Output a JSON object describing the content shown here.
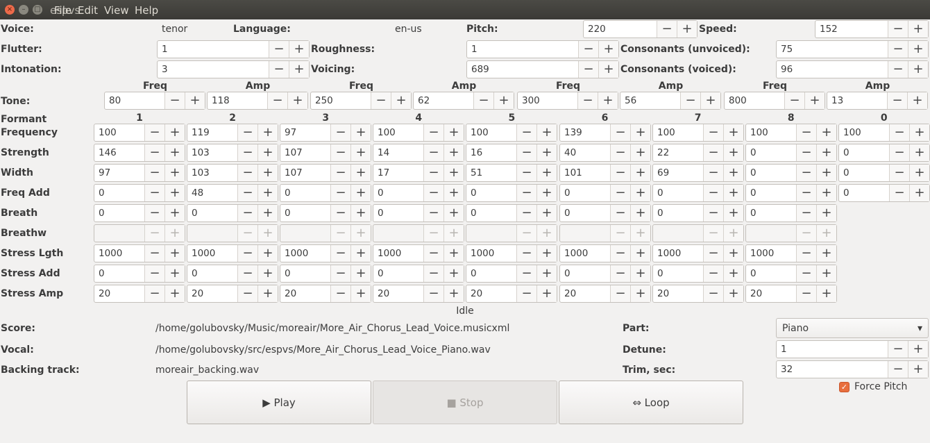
{
  "window": {
    "title": "espvs",
    "menu": [
      "File",
      "Edit",
      "View",
      "Help"
    ]
  },
  "top": {
    "voice_label": "Voice:",
    "voice": "tenor",
    "language_label": "Language:",
    "language": "en-us",
    "pitch_label": "Pitch:",
    "pitch": "220",
    "speed_label": "Speed:",
    "speed": "152",
    "flutter_label": "Flutter:",
    "flutter": "1",
    "roughness_label": "Roughness:",
    "roughness": "1",
    "cons_unvoiced_label": "Consonants (unvoiced):",
    "cons_unvoiced": "75",
    "intonation_label": "Intonation:",
    "intonation": "3",
    "voicing_label": "Voicing:",
    "voicing": "689",
    "cons_voiced_label": "Consonants (voiced):",
    "cons_voiced": "96"
  },
  "tone": {
    "label": "Tone:",
    "freq_header": "Freq",
    "amp_header": "Amp",
    "pairs": [
      {
        "freq": "80",
        "amp": "118"
      },
      {
        "freq": "250",
        "amp": "62"
      },
      {
        "freq": "300",
        "amp": "56"
      },
      {
        "freq": "800",
        "amp": "13"
      }
    ]
  },
  "formants": {
    "header_label": "Formant",
    "columns": [
      "1",
      "2",
      "3",
      "4",
      "5",
      "6",
      "7",
      "8",
      "0"
    ],
    "rows": [
      {
        "label": "Frequency",
        "values": [
          "100",
          "119",
          "97",
          "100",
          "100",
          "139",
          "100",
          "100",
          "100"
        ]
      },
      {
        "label": "Strength",
        "values": [
          "146",
          "103",
          "107",
          "14",
          "16",
          "40",
          "22",
          "0",
          "0"
        ]
      },
      {
        "label": "Width",
        "values": [
          "97",
          "103",
          "107",
          "17",
          "51",
          "101",
          "69",
          "0",
          "0"
        ]
      },
      {
        "label": "Freq Add",
        "values": [
          "0",
          "48",
          "0",
          "0",
          "0",
          "0",
          "0",
          "0",
          "0"
        ]
      },
      {
        "label": "Breath",
        "values": [
          "0",
          "0",
          "0",
          "0",
          "0",
          "0",
          "0",
          "0"
        ]
      },
      {
        "label": "Breathw",
        "values": [
          "",
          "",
          "",
          "",
          "",
          "",
          "",
          ""
        ],
        "disabled": true
      },
      {
        "label": "Stress Lgth",
        "values": [
          "1000",
          "1000",
          "1000",
          "1000",
          "1000",
          "1000",
          "1000",
          "1000"
        ]
      },
      {
        "label": "Stress Add",
        "values": [
          "0",
          "0",
          "0",
          "0",
          "0",
          "0",
          "0",
          "0"
        ]
      },
      {
        "label": "Stress Amp",
        "values": [
          "20",
          "20",
          "20",
          "20",
          "20",
          "20",
          "20",
          "20"
        ]
      }
    ]
  },
  "status": "Idle",
  "files": {
    "score_label": "Score:",
    "score": "/home/golubovsky/Music/moreair/More_Air_Chorus_Lead_Voice.musicxml",
    "vocal_label": "Vocal:",
    "vocal": "/home/golubovsky/src/espvs/More_Air_Chorus_Lead_Voice_Piano.wav",
    "backing_label": "Backing track:",
    "backing": "moreair_backing.wav"
  },
  "right": {
    "part_label": "Part:",
    "part": "Piano",
    "detune_label": "Detune:",
    "detune": "1",
    "trim_label": "Trim, sec:",
    "trim": "32",
    "force_pitch_label": "Force Pitch",
    "force_pitch": true
  },
  "buttons": {
    "play": "▶ Play",
    "stop": "■ Stop",
    "loop": "⇔ Loop"
  },
  "glyphs": {
    "minus": "−",
    "plus": "+",
    "close": "×",
    "minimize": "–",
    "maximize": "□",
    "dropdown": "▾",
    "check": "✓"
  }
}
